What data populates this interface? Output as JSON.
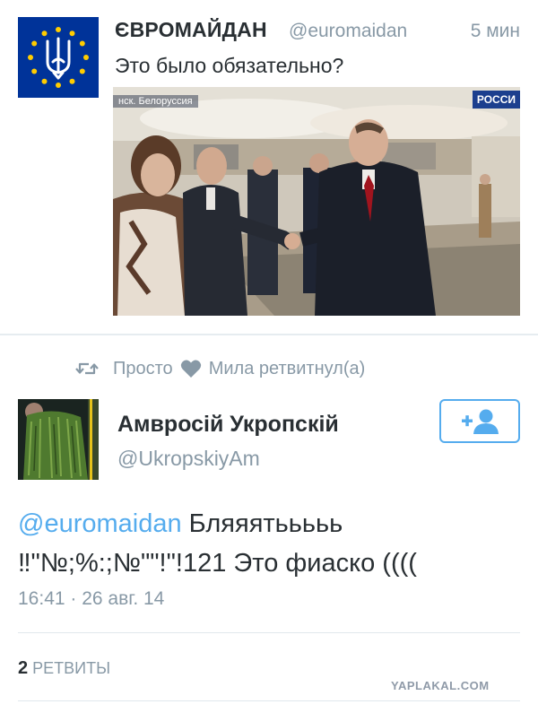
{
  "tweet_top": {
    "author_name": "ЄВРОМАЙДАН",
    "author_handle": "@euromaidan",
    "time": "5 мин",
    "text": "Это было обязательно?",
    "photo": {
      "channel_caption": "нск. Белоруссия",
      "channel_logo": "РОССИ"
    }
  },
  "retweet_context": {
    "part1": "Просто",
    "part2": "Мила ретвитнул(а)",
    "icons": [
      "retweet-icon",
      "heart-icon"
    ]
  },
  "tweet_main": {
    "author_name": "Амвросій Укропскій",
    "author_handle": "@UkropskiyAm",
    "follow_icon": "add-user-icon",
    "mention": "@euromaidan",
    "text_line1": " Бляяятььььь",
    "text_line2": "‼\"№;%:;№\"\"!\"!121 Это фиаско ((((",
    "meta": "16:41 · 26 авг. 14",
    "retweets_count": "2",
    "retweets_label": "РЕТВИТЫ"
  },
  "watermark": "YAPLAKAL.COM",
  "colors": {
    "accent": "#55acee",
    "muted": "#8899a6",
    "text": "#292f33",
    "eu_blue": "#003399",
    "eu_gold": "#ffcc00"
  }
}
